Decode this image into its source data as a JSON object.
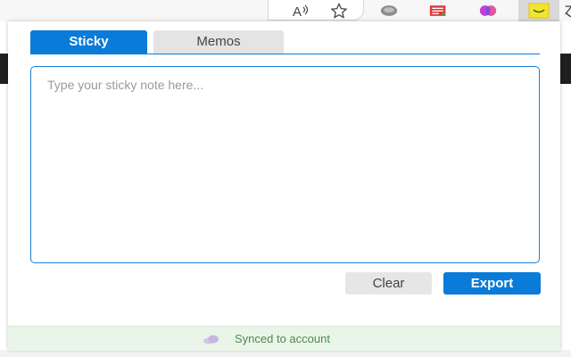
{
  "toolbar": {
    "icons": [
      "read-aloud-icon",
      "favorite-star-icon",
      "globe-extension-icon",
      "notes-extension-icon",
      "brain-extension-icon",
      "sticky-note-extension-icon"
    ],
    "edge_glyph": "Ɀ"
  },
  "popup": {
    "tabs": [
      {
        "label": "Sticky",
        "active": true
      },
      {
        "label": "Memos",
        "active": false
      }
    ],
    "note": {
      "value": "",
      "placeholder": "Type your sticky note here..."
    },
    "buttons": {
      "clear_label": "Clear",
      "export_label": "Export"
    },
    "status": {
      "text": "Synced to account",
      "icon": "cloud-icon"
    }
  },
  "colors": {
    "accent": "#0a7bd8",
    "status_bg": "#eaf5ea",
    "status_text": "#4c8a4c"
  }
}
